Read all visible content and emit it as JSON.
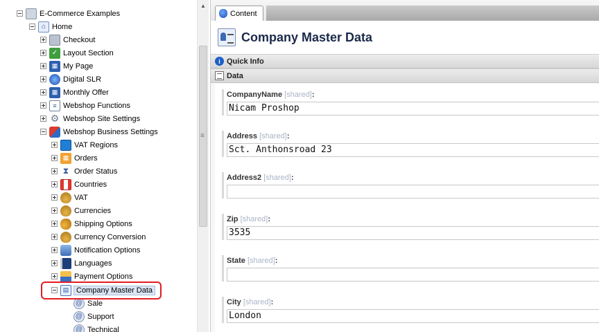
{
  "tree": {
    "root": "E-Commerce Examples",
    "home": "Home",
    "items": [
      {
        "label": "Checkout"
      },
      {
        "label": "Layout Section"
      },
      {
        "label": "My Page"
      },
      {
        "label": "Digital SLR"
      },
      {
        "label": "Monthly Offer"
      },
      {
        "label": "Webshop Functions"
      },
      {
        "label": "Webshop Site Settings"
      },
      {
        "label": "Webshop Business Settings"
      }
    ],
    "business_children": [
      {
        "label": "VAT Regions"
      },
      {
        "label": "Orders"
      },
      {
        "label": "Order Status"
      },
      {
        "label": "Countries"
      },
      {
        "label": "VAT"
      },
      {
        "label": "Currencies"
      },
      {
        "label": "Shipping Options"
      },
      {
        "label": "Currency Conversion"
      },
      {
        "label": "Notification Options"
      },
      {
        "label": "Languages"
      },
      {
        "label": "Payment Options"
      },
      {
        "label": "Company Master Data"
      }
    ],
    "company_children": [
      {
        "label": "Sale"
      },
      {
        "label": "Support"
      },
      {
        "label": "Technical"
      }
    ]
  },
  "tabs": {
    "content": "Content"
  },
  "header": {
    "title": "Company Master Data"
  },
  "sections": {
    "quick_info": "Quick Info",
    "data": "Data"
  },
  "fields": [
    {
      "name": "CompanyName",
      "shared": "[shared]",
      "colon": ":",
      "value": "Nicam Proshop"
    },
    {
      "name": "Address",
      "shared": "[shared]",
      "colon": ":",
      "value": "Sct. Anthonsroad 23"
    },
    {
      "name": "Address2",
      "shared": "[shared]",
      "colon": ":",
      "value": ""
    },
    {
      "name": "Zip",
      "shared": "[shared]",
      "colon": ":",
      "value": "3535"
    },
    {
      "name": "State",
      "shared": "[shared]",
      "colon": ":",
      "value": ""
    },
    {
      "name": "City",
      "shared": "[shared]",
      "colon": ":",
      "value": "London"
    }
  ],
  "colors": {
    "highlight": "#e31b23",
    "accent": "#1f5fc7"
  }
}
